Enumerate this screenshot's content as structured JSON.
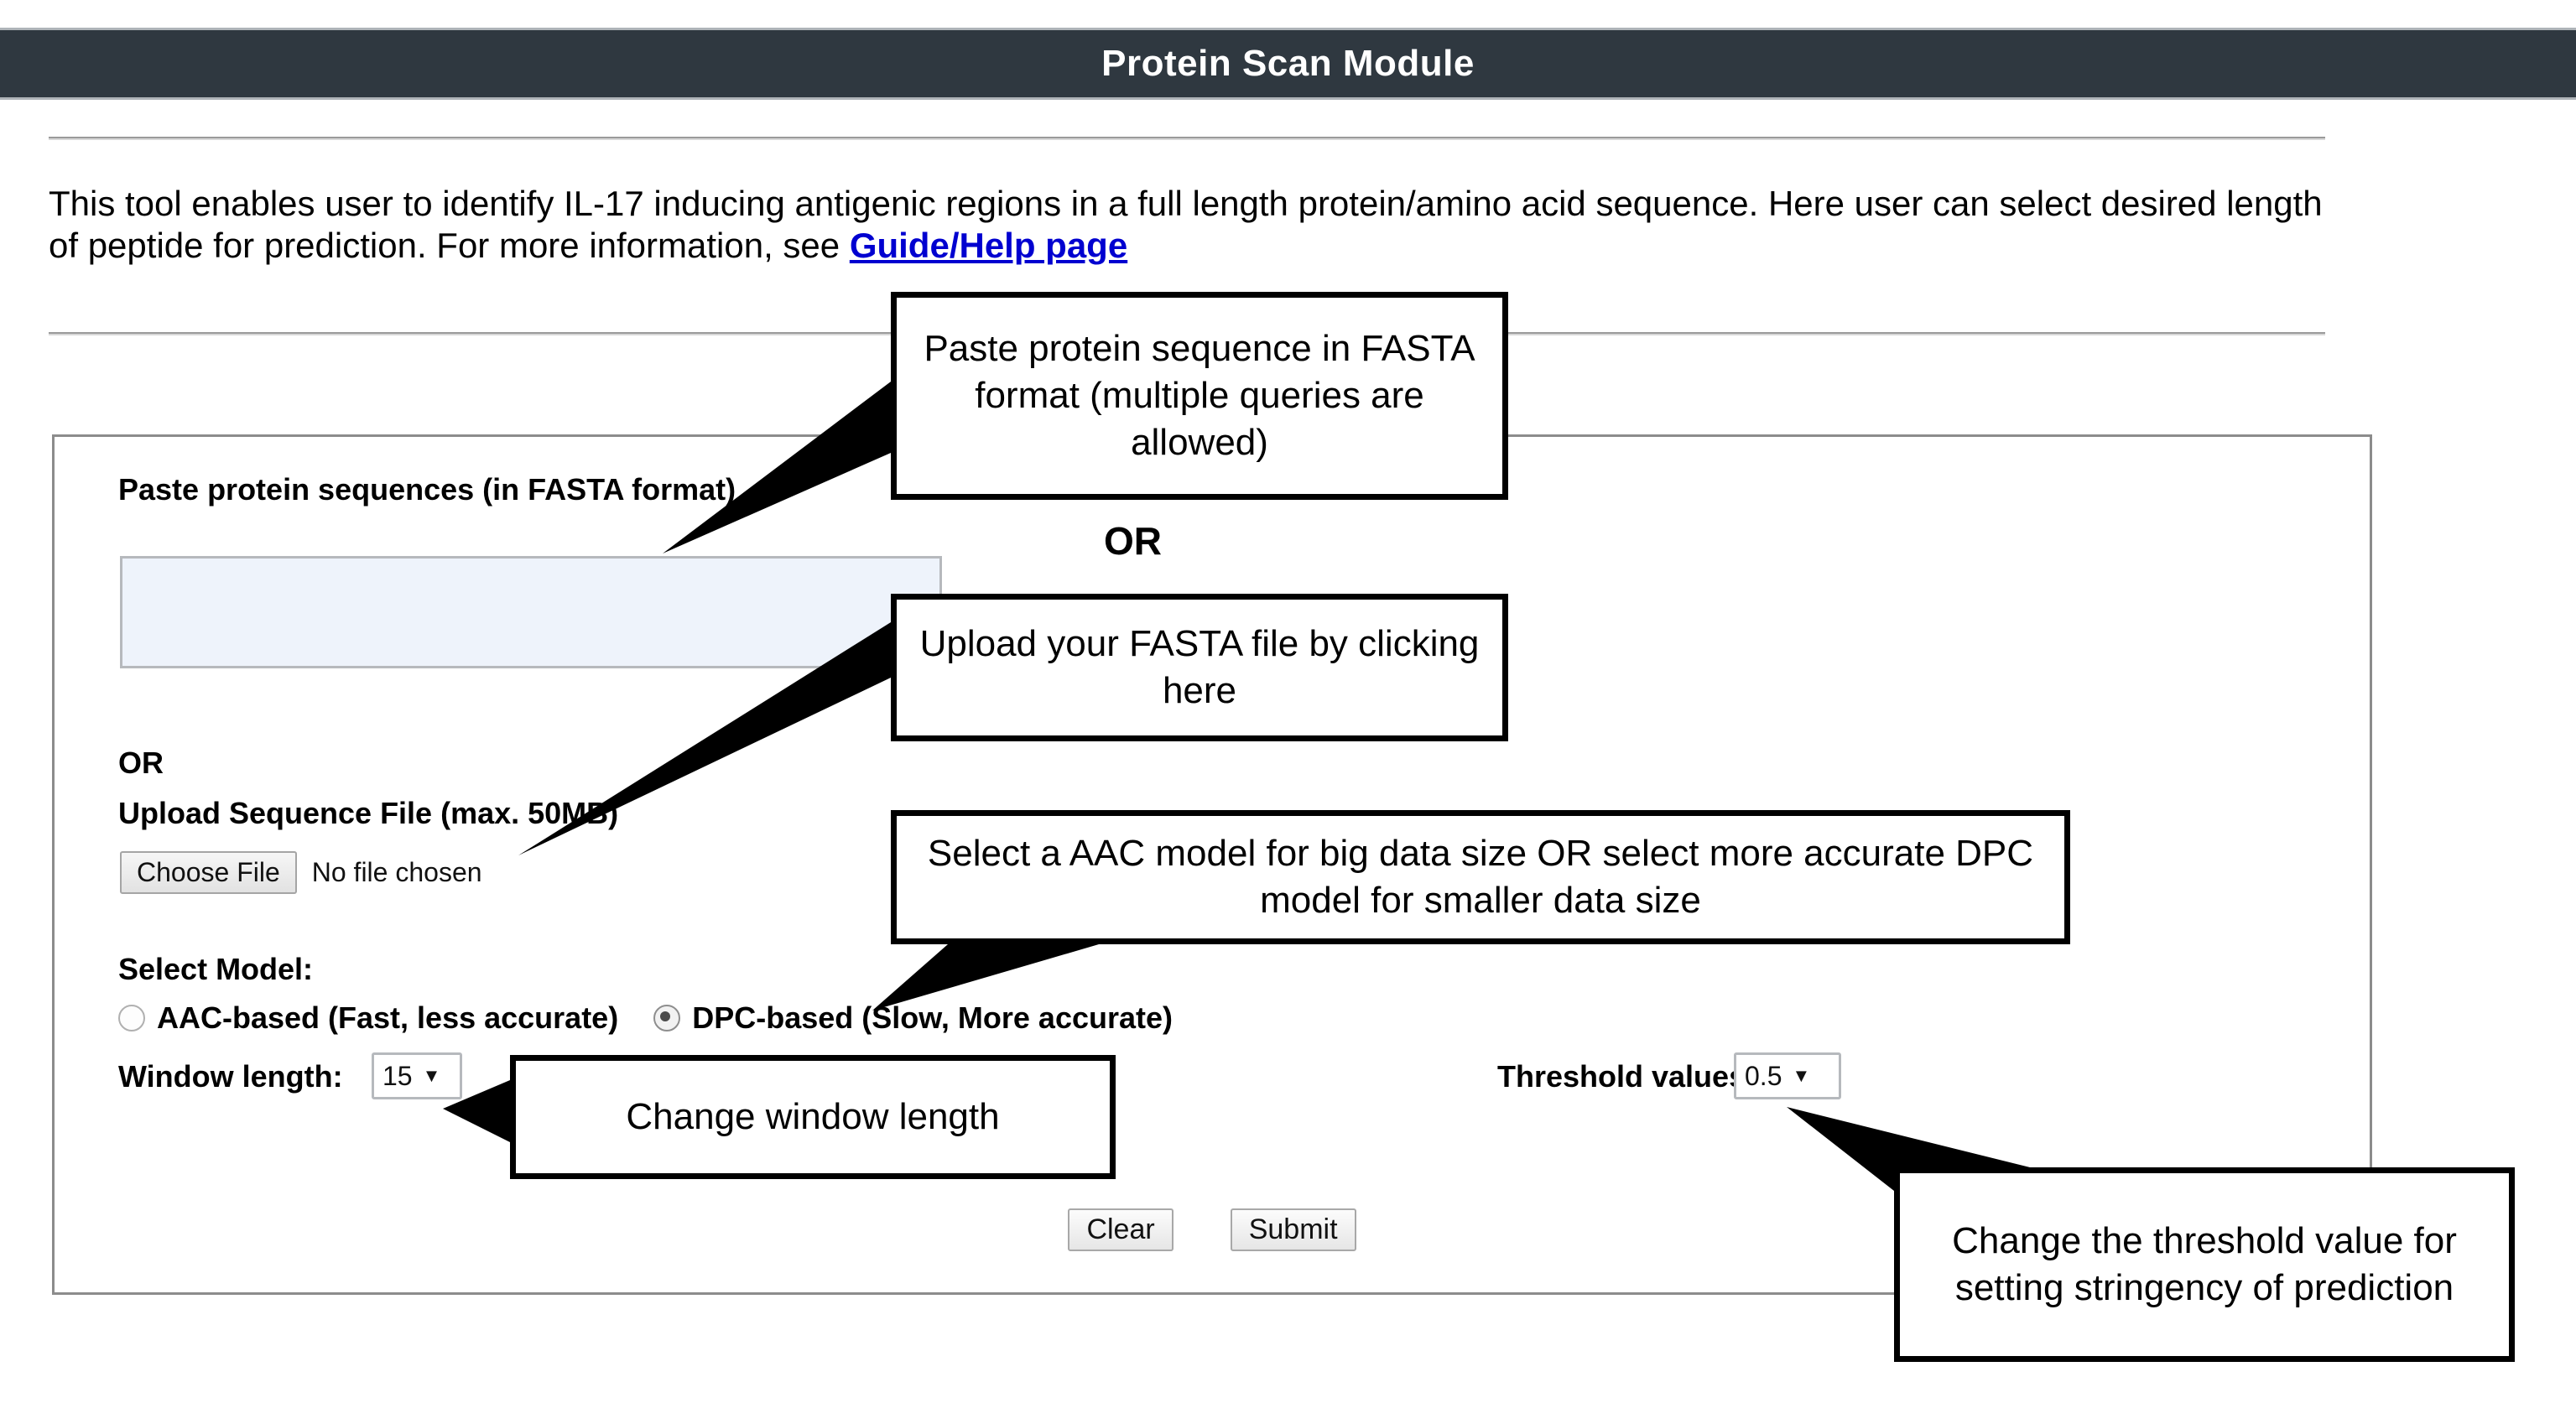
{
  "header": {
    "title": "Protein Scan Module"
  },
  "intro": {
    "text_before": "This tool enables user to identify IL-17 inducing antigenic regions in a full length protein/amino acid sequence. Here user can select desired length of peptide for prediction. For more information, see ",
    "link_text": "Guide/Help page"
  },
  "form": {
    "paste_label": "Paste protein sequences (in FASTA format)",
    "sequence_value": "",
    "sequence_placeholder": "",
    "or_label": "OR",
    "upload_label": "Upload Sequence File (max. 50MB)",
    "choose_file_label": "Choose File",
    "no_file_label": "No file chosen",
    "select_model_label": "Select Model:",
    "models": [
      {
        "label": "AAC-based (Fast, less accurate)",
        "selected": false
      },
      {
        "label": "DPC-based (Slow, More accurate)",
        "selected": true
      }
    ],
    "window_length_label": "Window length:",
    "window_length_value": "15",
    "threshold_label": "Threshold values:",
    "threshold_value": "0.5",
    "clear_label": "Clear",
    "submit_label": "Submit"
  },
  "annotations": {
    "or_between": "OR",
    "paste_callout": "Paste protein sequence in FASTA format (multiple queries are allowed)",
    "upload_callout": "Upload your FASTA file by clicking here",
    "model_callout": "Select a AAC model for big data size OR select more accurate DPC model for smaller data size",
    "window_callout": "Change window length",
    "threshold_callout": "Change the threshold value for setting stringency of prediction"
  },
  "colors": {
    "header_bg": "#2f3840",
    "header_text": "#ffffff",
    "link": "#0000d0",
    "textarea_bg": "#eef3fb",
    "panel_border": "#8c8c8c",
    "callout_border": "#000000"
  }
}
